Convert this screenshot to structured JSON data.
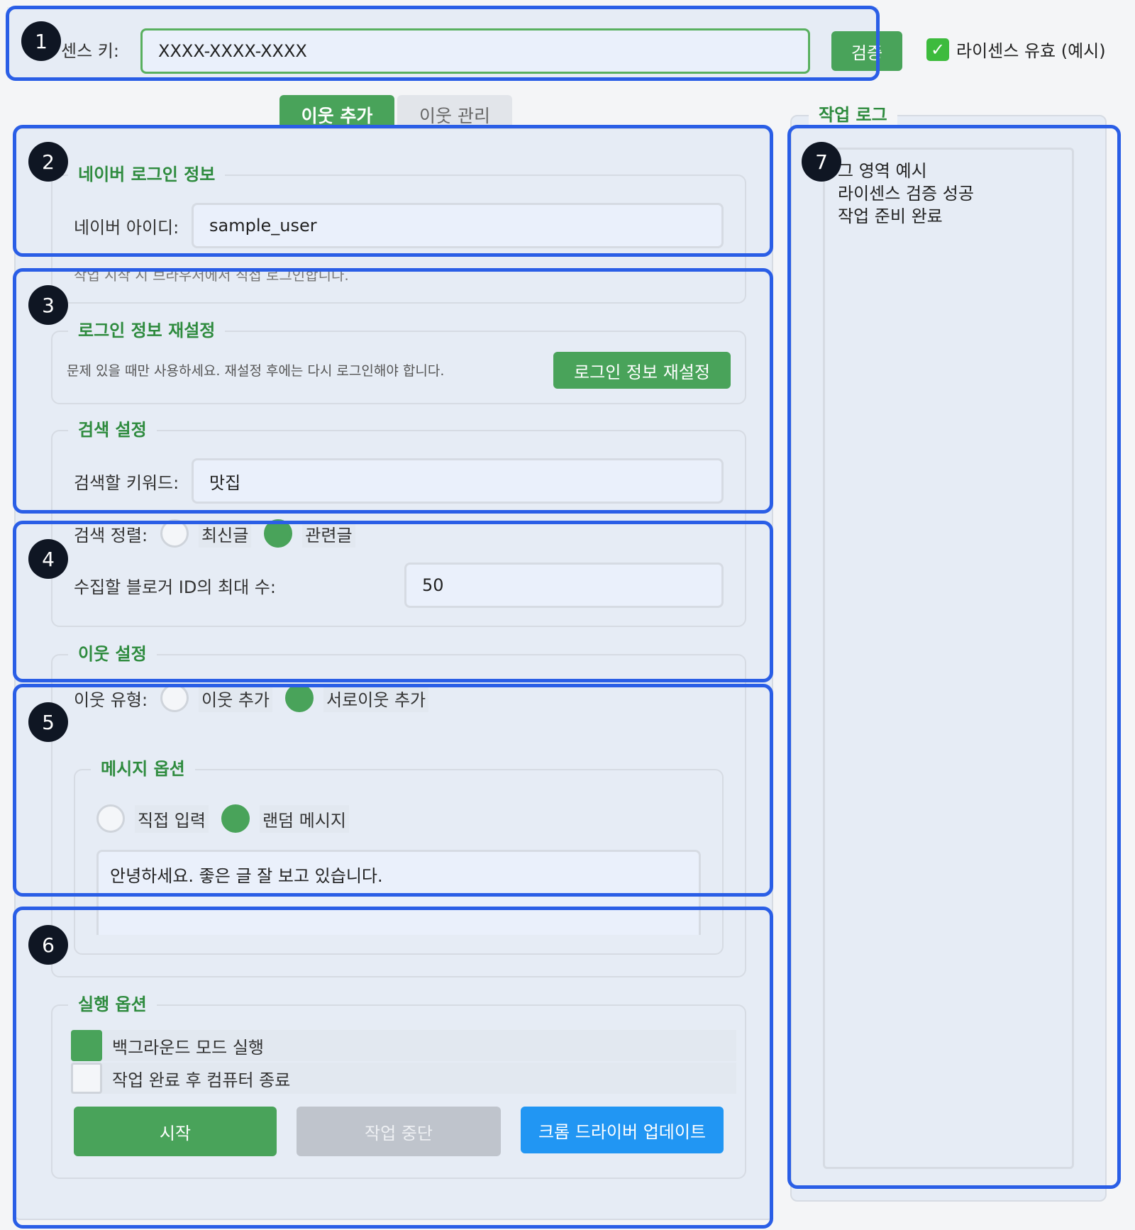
{
  "license": {
    "label": "라이센스 키:",
    "label_visible": "센스 키:",
    "value": "XXXX-XXXX-XXXX",
    "verify_button": "검증",
    "verify_visible": "검증",
    "status": "라이센스 유효 (예시)"
  },
  "tabs": [
    {
      "label": "이웃 추가",
      "active": true
    },
    {
      "label": "이웃 관리",
      "active": false
    }
  ],
  "naver_login": {
    "title": "네이버 로그인 정보",
    "id_label": "네이버 아이디:",
    "id_value": "sample_user",
    "note": "작업 시작 시 브라우저에서 직접 로그인합니다."
  },
  "reset": {
    "title": "로그인 정보 재설정",
    "description": "문제 있을 때만 사용하세요. 재설정 후에는 다시 로그인해야 합니다.",
    "button": "로그인 정보 재설정"
  },
  "search": {
    "title": "검색 설정",
    "keyword_label": "검색할 키워드:",
    "keyword_value": "맛집",
    "sort_label": "검색 정렬:",
    "sort_options": [
      "최신글",
      "관련글"
    ],
    "sort_selected": "관련글",
    "max_label": "수집할 블로거 ID의 최대 수:",
    "max_value": "50"
  },
  "neighbor": {
    "title": "이웃 설정",
    "type_label": "이웃 유형:",
    "type_options": [
      "이웃 추가",
      "서로이웃 추가"
    ],
    "type_selected": "서로이웃 추가"
  },
  "message": {
    "title": "메시지 옵션",
    "options": [
      "직접 입력",
      "랜덤 메시지"
    ],
    "selected": "랜덤 메시지",
    "text": "안녕하세요. 좋은 글 잘 보고 있습니다."
  },
  "run": {
    "title": "실행 옵션",
    "background_label": "백그라운드 모드 실행",
    "background_checked": true,
    "shutdown_label": "작업 완료 후 컴퓨터 종료",
    "shutdown_checked": false,
    "start_button": "시작",
    "stop_button": "작업 중단",
    "update_button": "크롬 드라이버 업데이트"
  },
  "log": {
    "title": "작업 로그",
    "lines": [
      "로그 영역 예시",
      "라이센스 검증 성공",
      "작업 준비 완료"
    ],
    "first_visible": "그 영역 예시"
  },
  "annotations": [
    "1",
    "2",
    "3",
    "4",
    "5",
    "6",
    "7"
  ],
  "colors": {
    "green": "#49a35a",
    "title_green": "#2e8b3e",
    "blue_button": "#2196f3",
    "overlay_blue": "#2a5ee6",
    "disabled": "#bfc4cc"
  }
}
